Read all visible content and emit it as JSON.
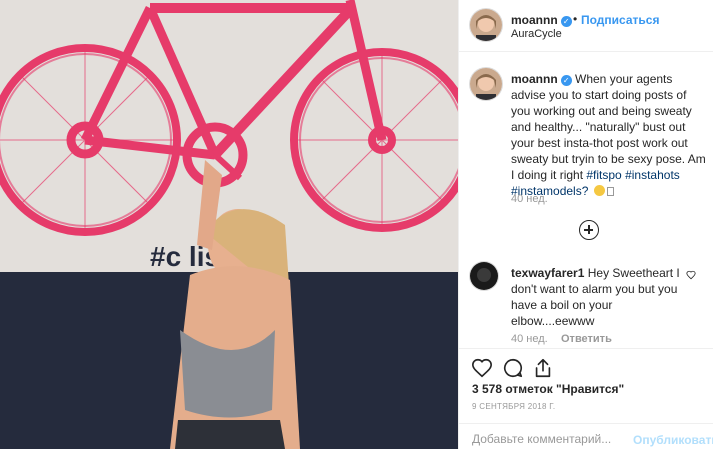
{
  "post": {
    "photo_wall_text": "#c     liss"
  },
  "header": {
    "username": "moannn",
    "verified_icon": "verified-badge-icon",
    "separator": "•",
    "follow_label": "Подписаться",
    "location": "AuraCycle"
  },
  "caption": {
    "username": "moannn",
    "text": " When your agents advise you to start doing posts of you working out and being sweaty and healthy... \"naturally\" bust out your best insta-thot post work out sweaty but tryin to be sexy pose. Am I doing it right ",
    "hashtags": [
      "#fitspo",
      "#instahots",
      "#instamodels?"
    ],
    "time": "40 нед."
  },
  "comment": {
    "username": "texwayfarer1",
    "text": " Hey Sweetheart I don't want to alarm you but you have a boil on your elbow....eewww",
    "time": "40 нед.",
    "reply_label": "Ответить"
  },
  "stats": {
    "likes": "3 578 отметок \"Нравится\"",
    "date": "9 СЕНТЯБРЯ 2018 Г."
  },
  "add_comment": {
    "placeholder": "Добавьте комментарий...",
    "publish_label": "Опубликовать"
  },
  "colors": {
    "link": "#3897f0",
    "hashtag": "#003569",
    "muted": "#999999",
    "bike": "#e63b6a"
  }
}
